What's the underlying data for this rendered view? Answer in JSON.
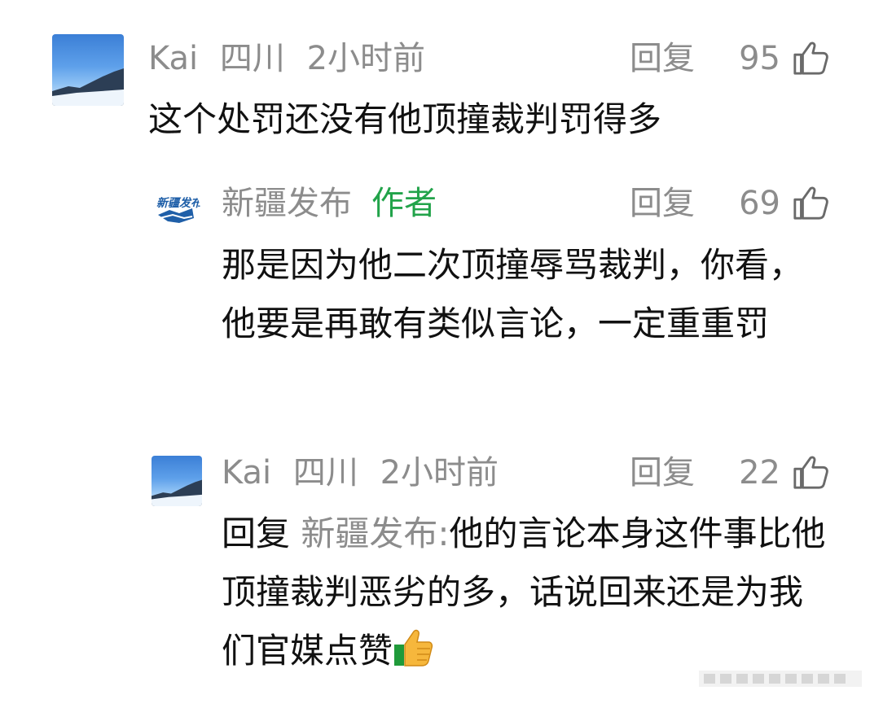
{
  "comments": [
    {
      "user": "Kai",
      "location": "四川",
      "time": "2小时前",
      "reply_label": "回复",
      "likes": "95",
      "text": "这个处罚还没有他顶撞裁判罚得多"
    },
    {
      "user": "新疆发布",
      "author_tag": "作者",
      "reply_label": "回复",
      "likes": "69",
      "logo_text": "新疆发布",
      "text": "那是因为他二次顶撞辱骂裁判，你看，他要是再敢有类似言论，一定重重罚"
    },
    {
      "user": "Kai",
      "location": "四川",
      "time": "2小时前",
      "reply_label": "回复",
      "likes": "22",
      "reply_prefix": "回复",
      "reply_target": "新疆发布:",
      "text": "他的言论本身这件事比他顶撞裁判恶劣的多，话说回来还是为我们官媒点赞"
    }
  ],
  "icons": {
    "like": "thumbs-up-outline-icon",
    "emoji": "thumbs-up-emoji-icon"
  },
  "colors": {
    "meta_text": "#8c8c8c",
    "body_text": "#111111",
    "author_tag": "#22a34a",
    "logo_blue": "#1f5fa8"
  }
}
